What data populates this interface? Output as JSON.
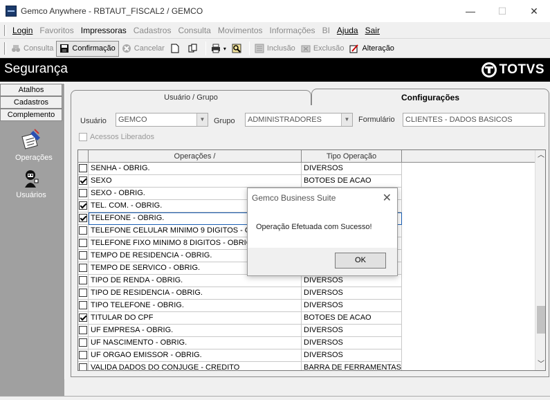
{
  "window": {
    "title": "Gemco Anywhere - RBTAUT_FISCAL2 / GEMCO",
    "minimize_glyph": "—",
    "maximize_glyph": "☐",
    "close_glyph": "✕"
  },
  "menu": {
    "items": [
      {
        "label": "Login",
        "enabled": true
      },
      {
        "label": "Favoritos",
        "enabled": false
      },
      {
        "label": "Impressoras",
        "enabled": true
      },
      {
        "label": "Cadastros",
        "enabled": false
      },
      {
        "label": "Consulta",
        "enabled": false
      },
      {
        "label": "Movimentos",
        "enabled": false
      },
      {
        "label": "Informações",
        "enabled": false
      },
      {
        "label": "BI",
        "enabled": false
      },
      {
        "label": "Ajuda",
        "enabled": true
      },
      {
        "label": "Sair",
        "enabled": true
      }
    ]
  },
  "toolbar": {
    "consulta": "Consulta",
    "confirmacao": "Confirmação",
    "cancelar": "Cancelar",
    "inclusao": "Inclusão",
    "exclusao": "Exclusão",
    "alteracao": "Alteração"
  },
  "header": {
    "title": "Segurança",
    "brand": "TOTVS"
  },
  "sidebar": {
    "buttons": [
      "Atalhos",
      "Cadastros",
      "Complemento"
    ],
    "icons": [
      {
        "label": "Operações",
        "icon": "operations-icon"
      },
      {
        "label": "Usuários",
        "icon": "users-icon"
      }
    ]
  },
  "tabs": {
    "usuario_grupo": "Usuário  / Grupo",
    "configuracoes": "Configurações"
  },
  "filters": {
    "usuario_label": "Usuário",
    "usuario_value": "GEMCO",
    "grupo_label": "Grupo",
    "grupo_value": "ADMINISTRADORES",
    "formulario_label": "Formulário",
    "formulario_value": "CLIENTES - DADOS BASICOS",
    "acessos_label": "Acessos Liberados"
  },
  "grid": {
    "col_operacoes": "Operações  /",
    "col_tipo": "Tipo Operação",
    "rows": [
      {
        "checked": false,
        "op": "SENHA - OBRIG.",
        "tipo": "DIVERSOS"
      },
      {
        "checked": true,
        "op": "SEXO",
        "tipo": "BOTOES DE ACAO"
      },
      {
        "checked": false,
        "op": "SEXO - OBRIG.",
        "tipo": ""
      },
      {
        "checked": true,
        "op": "TEL. COM. - OBRIG.",
        "tipo": ""
      },
      {
        "checked": true,
        "op": "TELEFONE - OBRIG.",
        "tipo": ""
      },
      {
        "checked": false,
        "op": "TELEFONE CELULAR MINIMO 9 DIGITOS - OB",
        "tipo": ""
      },
      {
        "checked": false,
        "op": "TELEFONE FIXO MINIMO 8 DIGITOS - OBRIG.",
        "tipo": ""
      },
      {
        "checked": false,
        "op": "TEMPO DE RESIDENCIA - OBRIG.",
        "tipo": ""
      },
      {
        "checked": false,
        "op": "TEMPO DE SERVICO - OBRIG.",
        "tipo": ""
      },
      {
        "checked": false,
        "op": "TIPO DE RENDA - OBRIG.",
        "tipo": "DIVERSOS"
      },
      {
        "checked": false,
        "op": "TIPO DE RESIDENCIA - OBRIG.",
        "tipo": "DIVERSOS"
      },
      {
        "checked": false,
        "op": "TIPO TELEFONE - OBRIG.",
        "tipo": "DIVERSOS"
      },
      {
        "checked": true,
        "op": "TITULAR DO CPF",
        "tipo": "BOTOES DE ACAO"
      },
      {
        "checked": false,
        "op": "UF EMPRESA - OBRIG.",
        "tipo": "DIVERSOS"
      },
      {
        "checked": false,
        "op": "UF NASCIMENTO - OBRIG.",
        "tipo": "DIVERSOS"
      },
      {
        "checked": false,
        "op": "UF ORGAO EMISSOR - OBRIG.",
        "tipo": "DIVERSOS"
      },
      {
        "checked": false,
        "op": "VALIDA DADOS DO CONJUGE - CREDITO",
        "tipo": "BARRA DE FERRAMENTAS"
      }
    ],
    "selected_row": 4,
    "scroll_position": 0.85
  },
  "dialog": {
    "title": "Gemco Business Suite",
    "message": "Operação Efetuada com Sucesso!",
    "ok": "OK"
  }
}
